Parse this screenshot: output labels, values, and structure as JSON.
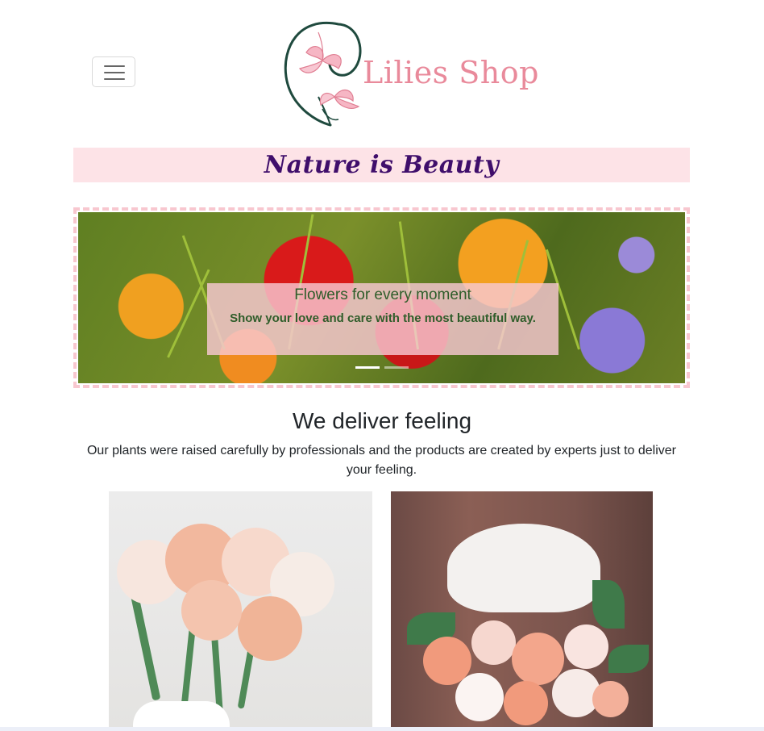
{
  "header": {
    "menu_toggle": "menu-icon",
    "logo_text": "Lilies Shop",
    "tagline": "Nature is Beauty"
  },
  "carousel": {
    "caption_title": "Flowers for every moment",
    "caption_text": "Show your love and care with the most beautiful way.",
    "slides_count": 2,
    "active_slide": 1
  },
  "section": {
    "heading": "We deliver feeling",
    "text": "Our plants were raised carefully by professionals and the products are created by experts just to deliver your feeling."
  },
  "colors": {
    "logo_pink": "#e98a9b",
    "tagline_purple": "#3f0e6b",
    "tagline_bg": "#fde3e7",
    "carousel_border": "#f8c7cf",
    "caption_green": "#2f5d2a"
  }
}
